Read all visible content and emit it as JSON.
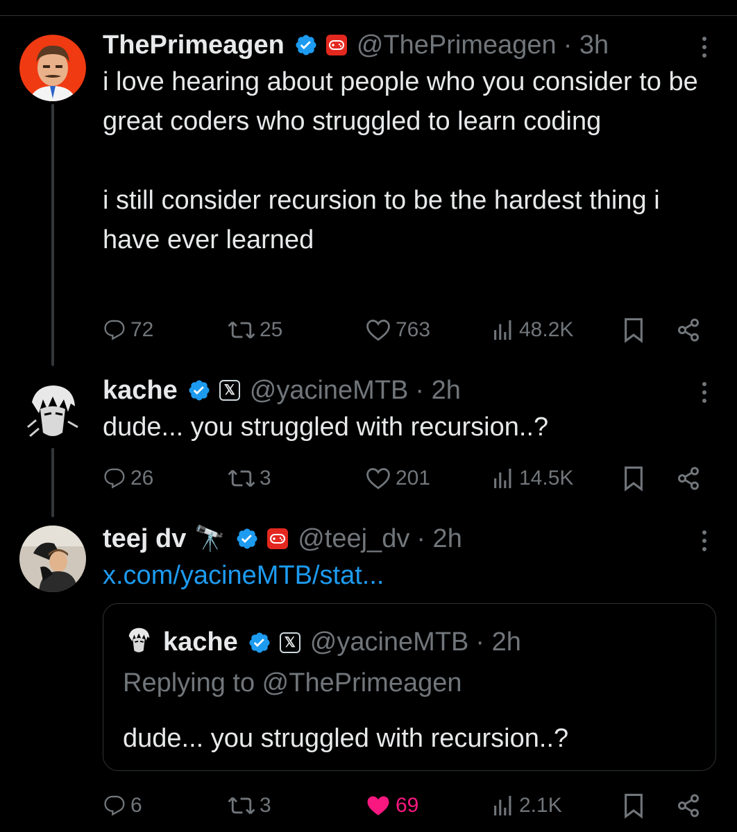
{
  "tweets": [
    {
      "name": "ThePrimeagen",
      "handle": "@ThePrimeagen",
      "time": "· 3h",
      "text": "i love hearing about people who you consider to be great coders who struggled to learn coding\n\ni still consider recursion to be the hardest thing i have ever learned",
      "replies": "72",
      "reposts": "25",
      "likes": "763",
      "views": "48.2K"
    },
    {
      "name": "kache",
      "handle": "@yacineMTB",
      "time": "· 2h",
      "text": "dude... you struggled with recursion..?",
      "replies": "26",
      "reposts": "3",
      "likes": "201",
      "views": "14.5K"
    },
    {
      "name": "teej dv",
      "name_emoji": "🔭",
      "handle": "@teej_dv",
      "time": "· 2h",
      "link": "x.com/yacineMTB/stat...",
      "quote": {
        "name": "kache",
        "handle": "@yacineMTB",
        "time": "· 2h",
        "replying_to": "Replying to @ThePrimeagen",
        "text": "dude... you struggled with recursion..?"
      },
      "replies": "6",
      "reposts": "3",
      "likes": "69",
      "views": "2.1K",
      "liked": true
    }
  ],
  "colors": {
    "background": "#000000",
    "text": "#e7e9ea",
    "muted": "#71767b",
    "link": "#1d9bf0",
    "verified": "#1d9bf0",
    "like_active": "#f91880",
    "affiliate_red": "#e3281f"
  },
  "icons": [
    "reply-icon",
    "repost-icon",
    "like-icon",
    "views-icon",
    "bookmark-icon",
    "share-icon",
    "verified-badge-icon",
    "more-icon"
  ]
}
